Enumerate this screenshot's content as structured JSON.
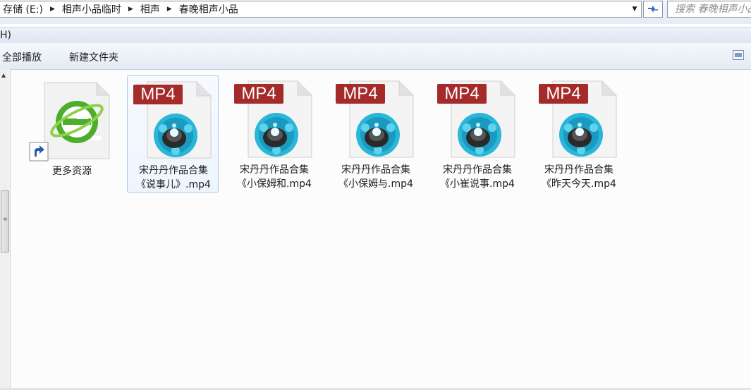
{
  "address": {
    "crumbs": [
      "存储 (E:)",
      "相声小品临时",
      "相声",
      "春晚相声小品"
    ]
  },
  "search": {
    "placeholder": "搜索 春晚相声小品"
  },
  "menu": {
    "partial_item": "H)"
  },
  "toolbar": {
    "play_all": "全部播放",
    "new_folder": "新建文件夹"
  },
  "files": [
    {
      "name_line1": "更多资源",
      "name_line2": "",
      "type": "ie-shortcut",
      "selected": false
    },
    {
      "name_line1": "宋丹丹作品合集",
      "name_line2": "《说事儿》.mp4",
      "type": "mp4",
      "badge": "MP4",
      "selected": true
    },
    {
      "name_line1": "宋丹丹作品合集",
      "name_line2": "《小保姆和.mp4",
      "type": "mp4",
      "badge": "MP4",
      "selected": false
    },
    {
      "name_line1": "宋丹丹作品合集",
      "name_line2": "《小保姆与.mp4",
      "type": "mp4",
      "badge": "MP4",
      "selected": false
    },
    {
      "name_line1": "宋丹丹作品合集",
      "name_line2": "《小崔说事.mp4",
      "type": "mp4",
      "badge": "MP4",
      "selected": false
    },
    {
      "name_line1": "宋丹丹作品合集",
      "name_line2": "《昨天今天.mp4",
      "type": "mp4",
      "badge": "MP4",
      "selected": false
    }
  ],
  "icons": {
    "dropdown": "chevron-down-icon",
    "refresh": "refresh-icon",
    "view": "view-options-icon",
    "shortcut": "shortcut-arrow-icon"
  },
  "colors": {
    "mp4_badge": "#a52a2a",
    "reel_cyan": "#29b6d8",
    "ie_green": "#4cae2a",
    "selection_border": "#a9cbee"
  }
}
